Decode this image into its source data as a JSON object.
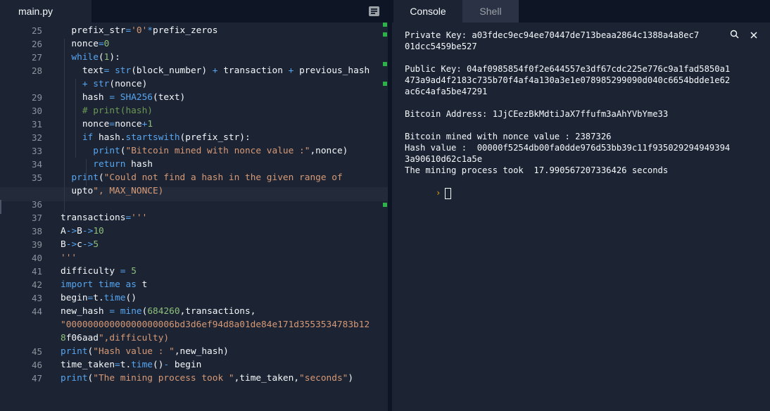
{
  "editor": {
    "tab_label": "main.py",
    "lines": [
      {
        "no": "25",
        "code": "  prefix_str='0'*prefix_zeros"
      },
      {
        "no": "26",
        "code": "  nonce=0"
      },
      {
        "no": "27",
        "code": "  while(1):"
      },
      {
        "no": "28",
        "code": "    text= str(block_number) + transaction + previous_hash"
      },
      {
        "no": "",
        "code": "    + str(nonce)"
      },
      {
        "no": "29",
        "code": "    hash = SHA256(text)"
      },
      {
        "no": "30",
        "code": "    # print(hash)"
      },
      {
        "no": "31",
        "code": "    nonce=nonce+1"
      },
      {
        "no": "32",
        "code": "    if hash.startswith(prefix_str):"
      },
      {
        "no": "33",
        "code": "      print(\"Bitcoin mined with nonce value :\",nonce)"
      },
      {
        "no": "34",
        "code": "      return hash"
      },
      {
        "no": "35",
        "code": "  print(\"Could not find a hash in the given range of"
      },
      {
        "no": "",
        "code": "  upto\", MAX_NONCE)"
      },
      {
        "no": "36",
        "code": ""
      },
      {
        "no": "37",
        "code": "transactions='''"
      },
      {
        "no": "38",
        "code": "A->B->10"
      },
      {
        "no": "39",
        "code": "B->c->5"
      },
      {
        "no": "40",
        "code": "'''"
      },
      {
        "no": "41",
        "code": "difficulty = 5"
      },
      {
        "no": "42",
        "code": "import time as t"
      },
      {
        "no": "43",
        "code": "begin=t.time()"
      },
      {
        "no": "44",
        "code": "new_hash = mine(684260,transactions,"
      },
      {
        "no": "",
        "code": "\"00000000000000000006bd3d6ef94d8a01de84e171d3553534783b12"
      },
      {
        "no": "",
        "code": "8f06aad\",difficulty)"
      },
      {
        "no": "45",
        "code": "print(\"Hash value : \",new_hash)"
      },
      {
        "no": "46",
        "code": "time_taken=t.time()- begin"
      },
      {
        "no": "47",
        "code": "print(\"The mining process took \",time_taken,\"seconds\")"
      }
    ]
  },
  "console": {
    "tabs": [
      "Console",
      "Shell"
    ],
    "output": [
      "Private Key: a03fdec9ec94ee70447de713beaa2864c1388a4a8ec7",
      "01dcc5459be527",
      "",
      "Public Key: 04af0985854f0f2e644557e3df67cdc225e776c9a1fad5850a1",
      "473a9ad4f2183c735b70f4af4a130a3e1e078985299090d040c6654bdde1e62",
      "ac6c4afa5be47291",
      "",
      "Bitcoin Address: 1JjCEezBkMdtiJaX7ffufm3aAhYVbYme33",
      "",
      "Bitcoin mined with nonce value : 2387326",
      "Hash value :  00000f5254db00fa0dde976d53bb39c11f935029294949394",
      "3a90610d62c1a5e",
      "The mining process took  17.990567207336426 seconds"
    ],
    "prompt_symbol": "›"
  }
}
